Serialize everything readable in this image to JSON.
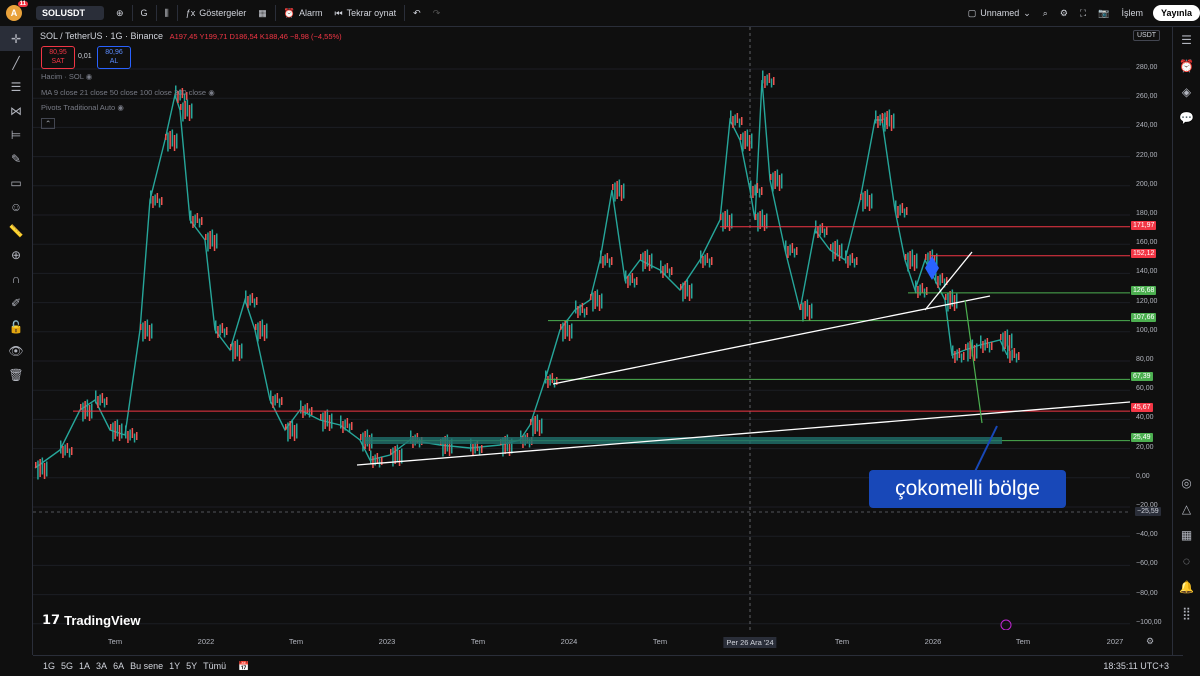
{
  "topbar": {
    "avatar": "A",
    "notifications": "11",
    "symbol": "SOLUSDT",
    "interval": "G",
    "indicators": "Göstergeler",
    "alarm": "Alarm",
    "replay": "Tekrar oynat",
    "layout_name": "Unnamed",
    "trade": "İşlem",
    "publish": "Yayınla"
  },
  "legend": {
    "title": "SOL / TetherUS · 1G · Binance",
    "ohlc": "A197,45  Y199,71  D186,54  K188,46  −8,98 (−4,55%)",
    "sell_price": "80,95",
    "sell_label": "SAT",
    "spread": "0,01",
    "buy_price": "80,96",
    "buy_label": "AL",
    "ind1": "Hacim · SOL",
    "ind2": "MA 9 close 21 close 50 close 100 close 200 close",
    "ind3": "Pivots Traditional Auto"
  },
  "currency": "USDT",
  "price_ticks": [
    "280,00",
    "260,00",
    "240,00",
    "220,00",
    "200,00",
    "180,00",
    "160,00",
    "140,00",
    "120,00",
    "100,00",
    "80,00",
    "60,00",
    "40,00",
    "20,00",
    "0,00",
    "−20,00",
    "−40,00",
    "−60,00",
    "−80,00",
    "−100,00"
  ],
  "price_labels": [
    {
      "text": "171,97",
      "color": "#f23645"
    },
    {
      "text": "152,12",
      "color": "#f23645"
    },
    {
      "text": "126,68",
      "color": "#4caf50"
    },
    {
      "text": "107,66",
      "color": "#4caf50"
    },
    {
      "text": "67,39",
      "color": "#4caf50"
    },
    {
      "text": "45,67",
      "color": "#f23645"
    },
    {
      "text": "25,49",
      "color": "#4caf50"
    },
    {
      "text": "−25,59",
      "color": "#2a2e39"
    }
  ],
  "x_ticks": [
    "Tem",
    "2022",
    "Tem",
    "2023",
    "Tem",
    "2024",
    "Tem",
    "Per 26 Ara '24",
    "Tem",
    "2026",
    "Tem",
    "2027"
  ],
  "annotation": "çokomelli bölge",
  "brand": "TradingView",
  "ranges": [
    "1G",
    "5G",
    "1A",
    "3A",
    "6A",
    "Bu sene",
    "1Y",
    "5Y",
    "Tümü"
  ],
  "clock": "18:35:11 UTC+3"
}
